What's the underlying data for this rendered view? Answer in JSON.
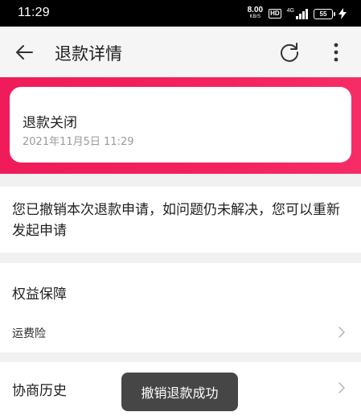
{
  "status_bar": {
    "time": "11:29",
    "net_speed_value": "8.00",
    "net_speed_unit": "KB/S",
    "hd_label": "HD",
    "network_type": "4G",
    "battery": "55"
  },
  "header": {
    "title": "退款详情",
    "icons": [
      "arrow-left-icon",
      "refresh-icon",
      "more-vertical-icon"
    ]
  },
  "refund_status": {
    "title": "退款关闭",
    "time": "2021年11月5日 11:29"
  },
  "notice": {
    "text": "您已撤销本次退款申请，如问题仍未解决，您可以重新发起申请"
  },
  "rights": {
    "title": "权益保障",
    "items": [
      {
        "label": "运费险"
      }
    ]
  },
  "history": {
    "title": "协商历史"
  },
  "toast": {
    "text": "撤销退款成功"
  },
  "colors": {
    "banner": "#f4225f",
    "toast_bg": "#3a3a3a"
  }
}
